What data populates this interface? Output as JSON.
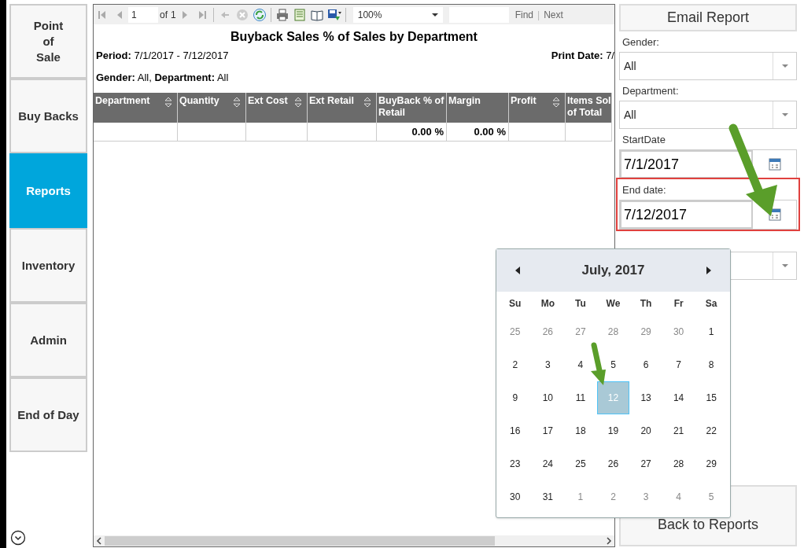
{
  "sidebar": {
    "items": [
      {
        "label": "Point\nof\nSale",
        "selected": false
      },
      {
        "label": "Buy Backs",
        "selected": false
      },
      {
        "label": "Reports",
        "selected": true
      },
      {
        "label": "Inventory",
        "selected": false
      },
      {
        "label": "Admin",
        "selected": false
      },
      {
        "label": "End of Day",
        "selected": false
      }
    ]
  },
  "report_viewer": {
    "toolbar": {
      "page": "1",
      "of_label": "of",
      "page_count": "1",
      "zoom": "100%",
      "find_label": "Find",
      "separator": "|",
      "next_label": "Next"
    },
    "title": "Buyback Sales % of Sales by Department",
    "period": "**Period:** 7/1/2017 - 7/12/2017",
    "print_date": "**Print Date:** 7/",
    "filters": "**Gender:** All, **Department:** All",
    "table": {
      "columns": [
        {
          "label": "Department",
          "sortable": true
        },
        {
          "label": "Quantity",
          "sortable": true
        },
        {
          "label": "Ext Cost",
          "sortable": true
        },
        {
          "label": "Ext Retail",
          "sortable": true
        },
        {
          "label": "BuyBack % of Retail",
          "sortable": false,
          "total": "0.00 %"
        },
        {
          "label": "Margin",
          "sortable": false,
          "total": "0.00 %"
        },
        {
          "label": "Profit",
          "sortable": true
        },
        {
          "label": "Items Sol of Total",
          "sortable": false
        }
      ]
    }
  },
  "right_panel": {
    "email_button": "Email Report",
    "fields": [
      {
        "kind": "select",
        "label": "Gender:",
        "value": "All",
        "highlighted": false
      },
      {
        "kind": "select",
        "label": "Department:",
        "value": "All",
        "highlighted": false
      },
      {
        "kind": "date",
        "label": "StartDate",
        "value": "7/1/2017",
        "highlighted": false
      },
      {
        "kind": "date",
        "label": "End date:",
        "value": "7/12/2017",
        "highlighted": true
      },
      {
        "kind": "select",
        "highlighted": false
      }
    ],
    "back_button": "Back to Reports"
  },
  "calendar": {
    "title": "July, 2017",
    "weekdays": [
      "Su",
      "Mo",
      "Tu",
      "We",
      "Th",
      "Fr",
      "Sa"
    ],
    "days": [
      {
        "text": "25",
        "other_month": true,
        "selected": false
      },
      {
        "text": "26",
        "other_month": true,
        "selected": false
      },
      {
        "text": "27",
        "other_month": true,
        "selected": false
      },
      {
        "text": "28",
        "other_month": true,
        "selected": false
      },
      {
        "text": "29",
        "other_month": true,
        "selected": false
      },
      {
        "text": "30",
        "other_month": true,
        "selected": false
      },
      {
        "text": "1",
        "other_month": false,
        "selected": false
      },
      {
        "text": "2",
        "other_month": false,
        "selected": false
      },
      {
        "text": "3",
        "other_month": false,
        "selected": false
      },
      {
        "text": "4",
        "other_month": false,
        "selected": false
      },
      {
        "text": "5",
        "other_month": false,
        "selected": false
      },
      {
        "text": "6",
        "other_month": false,
        "selected": false
      },
      {
        "text": "7",
        "other_month": false,
        "selected": false
      },
      {
        "text": "8",
        "other_month": false,
        "selected": false
      },
      {
        "text": "9",
        "other_month": false,
        "selected": false
      },
      {
        "text": "10",
        "other_month": false,
        "selected": false
      },
      {
        "text": "11",
        "other_month": false,
        "selected": false
      },
      {
        "text": "12",
        "other_month": false,
        "selected": true
      },
      {
        "text": "13",
        "other_month": false,
        "selected": false
      },
      {
        "text": "14",
        "other_month": false,
        "selected": false
      },
      {
        "text": "15",
        "other_month": false,
        "selected": false
      },
      {
        "text": "16",
        "other_month": false,
        "selected": false
      },
      {
        "text": "17",
        "other_month": false,
        "selected": false
      },
      {
        "text": "18",
        "other_month": false,
        "selected": false
      },
      {
        "text": "19",
        "other_month": false,
        "selected": false
      },
      {
        "text": "20",
        "other_month": false,
        "selected": false
      },
      {
        "text": "21",
        "other_month": false,
        "selected": false
      },
      {
        "text": "22",
        "other_month": false,
        "selected": false
      },
      {
        "text": "23",
        "other_month": false,
        "selected": false
      },
      {
        "text": "24",
        "other_month": false,
        "selected": false
      },
      {
        "text": "25",
        "other_month": false,
        "selected": false
      },
      {
        "text": "26",
        "other_month": false,
        "selected": false
      },
      {
        "text": "27",
        "other_month": false,
        "selected": false
      },
      {
        "text": "28",
        "other_month": false,
        "selected": false
      },
      {
        "text": "29",
        "other_month": false,
        "selected": false
      },
      {
        "text": "30",
        "other_month": false,
        "selected": false
      },
      {
        "text": "31",
        "other_month": false,
        "selected": false
      },
      {
        "text": "1",
        "other_month": true,
        "selected": false
      },
      {
        "text": "2",
        "other_month": true,
        "selected": false
      },
      {
        "text": "3",
        "other_month": true,
        "selected": false
      },
      {
        "text": "4",
        "other_month": true,
        "selected": false
      },
      {
        "text": "5",
        "other_month": true,
        "selected": false
      }
    ]
  }
}
